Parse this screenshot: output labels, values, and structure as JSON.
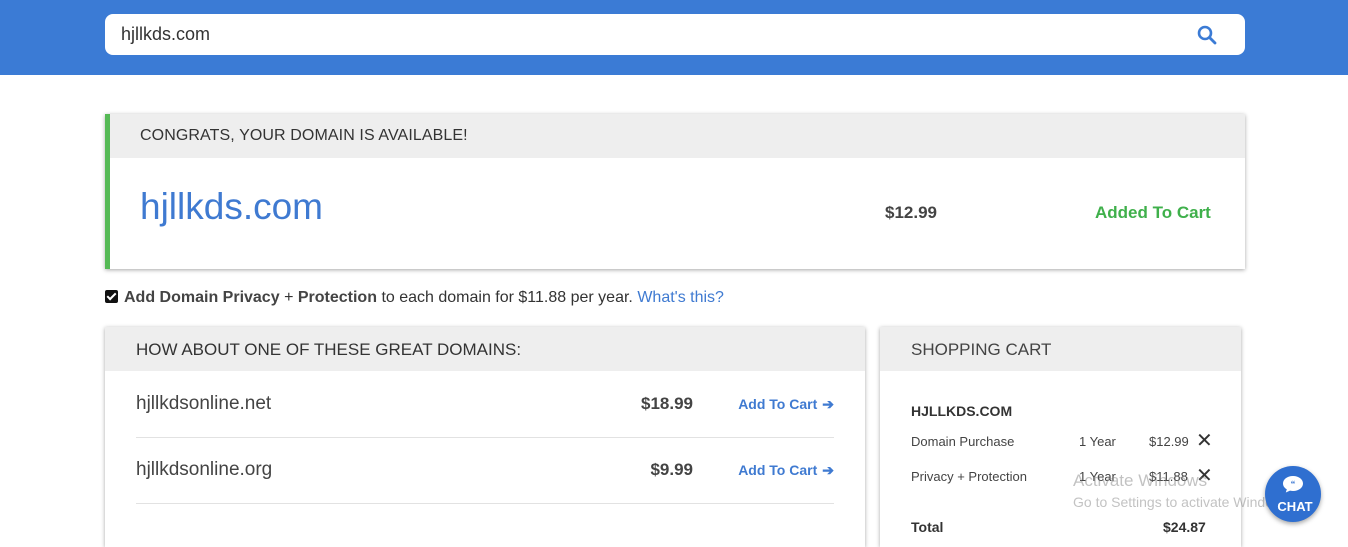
{
  "search": {
    "value": "hjllkds.com"
  },
  "available": {
    "heading": "CONGRATS, YOUR DOMAIN IS AVAILABLE!",
    "domain": "hjllkds.com",
    "price": "$12.99",
    "status": "Added To Cart"
  },
  "privacy": {
    "checked": true,
    "bold_text": "Add Domain Privacy",
    "plus": "+",
    "bold_text2": "Protection",
    "text": "to each domain for $11.88 per year.",
    "link": "What's this?"
  },
  "suggestions": {
    "heading": "HOW ABOUT ONE OF THESE GREAT DOMAINS:",
    "button_label": "Add To Cart",
    "items": [
      {
        "name": "hjllkdsonline.net",
        "price": "$18.99"
      },
      {
        "name": "hjllkdsonline.org",
        "price": "$9.99"
      }
    ]
  },
  "cart": {
    "heading": "SHOPPING CART",
    "domain": "HJLLKDS.COM",
    "lines": [
      {
        "name": "Domain Purchase",
        "term": "1 Year",
        "price": "$12.99"
      },
      {
        "name": "Privacy + Protection",
        "term": "1 Year",
        "price": "$11.88"
      }
    ],
    "total_label": "Total",
    "total_value": "$24.87"
  },
  "watermark": {
    "line1": "Activate Windows",
    "line2": "Go to Settings to activate Windows."
  },
  "chat": {
    "label": "CHAT"
  },
  "colors": {
    "brand": "#3b7bd5",
    "link": "#3f7ad1",
    "success": "#3fb04b"
  }
}
